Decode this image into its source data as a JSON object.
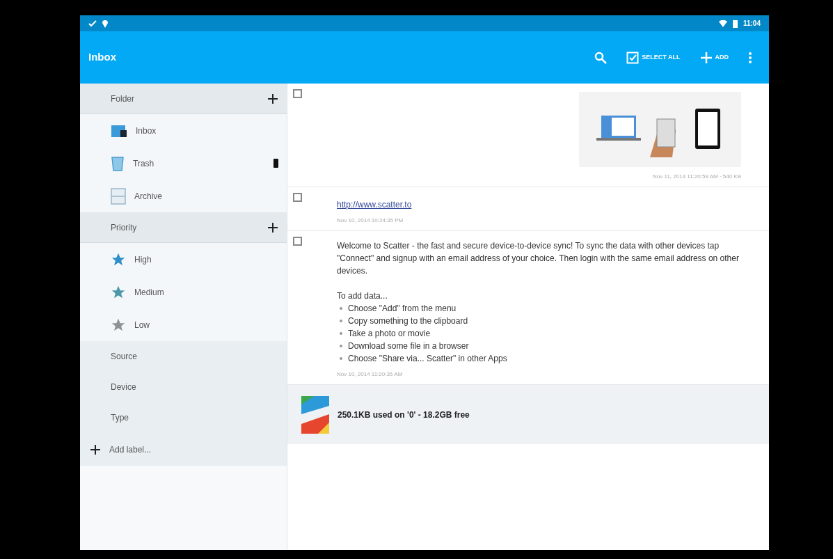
{
  "status_bar": {
    "time": "11:04"
  },
  "app_bar": {
    "title": "Inbox",
    "actions": [
      {
        "kind": "search"
      },
      {
        "kind": "select",
        "label": "SELECT ALL"
      },
      {
        "kind": "add",
        "label": "ADD"
      },
      {
        "kind": "more"
      }
    ]
  },
  "sidebar": {
    "sections": [
      {
        "label": "Folder",
        "expanded": true,
        "children": [
          {
            "label": "Inbox",
            "kind": "inbox"
          },
          {
            "label": "Trash",
            "kind": "trash"
          },
          {
            "label": "Archive",
            "kind": "archive"
          }
        ]
      },
      {
        "label": "Priority",
        "expanded": true,
        "children": [
          {
            "label": "High",
            "kind": "star",
            "color": "#2f8fc9"
          },
          {
            "label": "Medium",
            "kind": "star",
            "color": "#4d97a8"
          },
          {
            "label": "Low",
            "kind": "star",
            "color": "#8c9296"
          }
        ]
      },
      {
        "label": "Source",
        "expanded": false
      },
      {
        "label": "Device",
        "expanded": false
      },
      {
        "label": "Type",
        "expanded": false
      }
    ],
    "add_label": "Add label..."
  },
  "messages": [
    {
      "kind": "image",
      "checked": false,
      "timestamp": "Nov 11, 2014 11:20:59 AM · 540 KB"
    },
    {
      "kind": "link",
      "checked": false,
      "link": "http://www.scatter.to",
      "timestamp": "Nov 10, 2014 10:24:35 PM"
    },
    {
      "kind": "text",
      "checked": false,
      "paragraph": "Welcome to Scatter - the fast and secure device-to-device sync! To sync the data with other devices tap \"Connect\" and signup with an email address of your choice. Then login with the same email address on other devices.",
      "intro": "To add data...",
      "bullets": [
        "Choose \"Add\" from the menu",
        "Copy something to the clipboard",
        "Take a photo or movie",
        "Download some file in a browser",
        "Choose \"Share via... Scatter\" in other Apps"
      ],
      "timestamp": "Nov 10, 2014 11:20:35 AM"
    }
  ],
  "footer": {
    "storage": "250.1KB used on '0' - 18.2GB free"
  }
}
